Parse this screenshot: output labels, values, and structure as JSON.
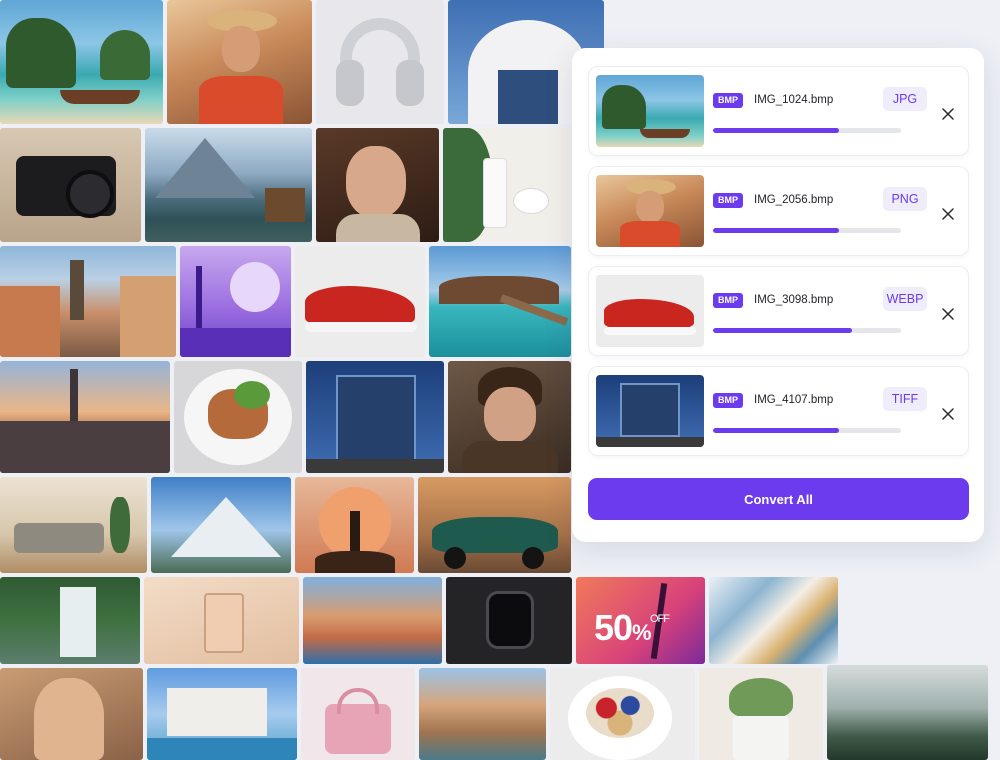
{
  "panel": {
    "convert_label": "Convert All",
    "files": [
      {
        "badge": "BMP",
        "name": "IMG_1024.bmp",
        "target": "JPG",
        "progress": 0.67,
        "thumb": "beach-boat-photo"
      },
      {
        "badge": "BMP",
        "name": "IMG_2056.bmp",
        "target": "PNG",
        "progress": 0.67,
        "thumb": "woman-hat-photo"
      },
      {
        "badge": "BMP",
        "name": "IMG_3098.bmp",
        "target": "WEBP",
        "progress": 0.74,
        "thumb": "red-sneaker-photo"
      },
      {
        "badge": "BMP",
        "name": "IMG_4107.bmp",
        "target": "TIFF",
        "progress": 0.67,
        "thumb": "glass-building-photo"
      }
    ]
  },
  "promo": {
    "value": "50",
    "percent": "%",
    "off": "OFF"
  },
  "colors": {
    "accent": "#6b3bed",
    "accent_light": "#efedfb"
  }
}
